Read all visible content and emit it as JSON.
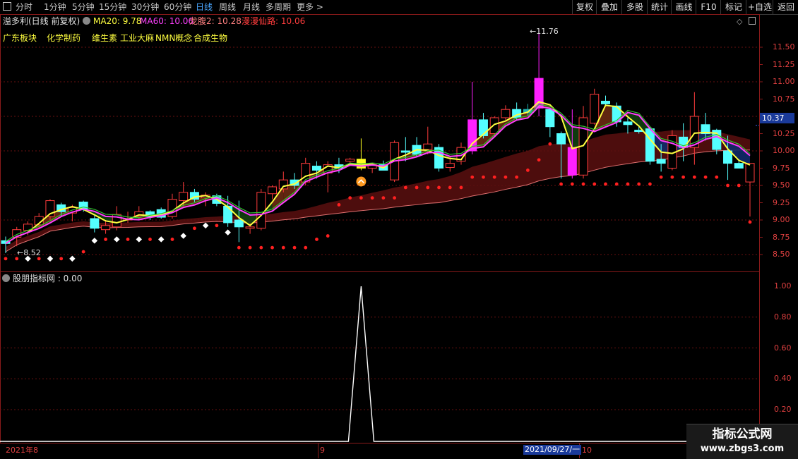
{
  "toolbar": {
    "menu_icon": "menu-icon",
    "periods": [
      "分时",
      "1分钟",
      "5分钟",
      "15分钟",
      "30分钟",
      "60分钟",
      "日线",
      "周线",
      "月线",
      "多周期",
      "更多 >"
    ],
    "active_period": "日线",
    "buttons": [
      "复权",
      "叠加",
      "多股",
      "统计",
      "画线",
      "F10",
      "标记",
      "+自选",
      "返回"
    ]
  },
  "main_panel": {
    "stock_title": "溢多利(日线 前复权)",
    "ma20": "MA20: 9.78",
    "ma60": "MA60: 10.06",
    "longbeidan": "龙腹2: 10.28",
    "manman": "漫漫仙路: 10.06",
    "concepts": [
      "广东板块",
      "化学制药",
      "维生素",
      "工业大麻",
      "NMN概念",
      "合成生物"
    ],
    "high_marker": "11.76",
    "low_marker": "8.52",
    "current_price": "10.37",
    "y_ticks": [
      "11.50",
      "11.25",
      "11.00",
      "10.75",
      "10.50",
      "10.25",
      "10.00",
      "9.75",
      "9.50",
      "9.25",
      "9.00",
      "8.75",
      "8.50"
    ]
  },
  "sub_panel": {
    "title": "股朋指标网 : 0.00",
    "y_ticks": [
      "1.00",
      "0.80",
      "0.60",
      "0.40",
      "0.20"
    ]
  },
  "date_axis": {
    "labels": [
      "2021年8",
      "9",
      "2021/09/27/一",
      "10"
    ]
  },
  "watermark": {
    "title": "指标公式网",
    "url": "www.zbgs3.com"
  },
  "colors": {
    "up": "#ff3c3c",
    "down": "#54ffff",
    "ma20": "#ffff40",
    "ma60": "#ff40ff",
    "grid": "#6a1010",
    "ribbon": "#7a1515"
  },
  "chart_data": {
    "type": "candlestick",
    "ylim": [
      8.4,
      11.85
    ],
    "candles": [
      {
        "o": 8.7,
        "h": 8.76,
        "l": 8.52,
        "c": 8.66
      },
      {
        "o": 8.75,
        "h": 8.9,
        "l": 8.62,
        "c": 8.86
      },
      {
        "o": 8.85,
        "h": 8.98,
        "l": 8.78,
        "c": 8.94
      },
      {
        "o": 8.93,
        "h": 9.1,
        "l": 8.88,
        "c": 9.05
      },
      {
        "o": 9.05,
        "h": 9.3,
        "l": 9.0,
        "c": 9.28
      },
      {
        "o": 9.22,
        "h": 9.25,
        "l": 9.05,
        "c": 9.12
      },
      {
        "o": 9.1,
        "h": 9.22,
        "l": 8.98,
        "c": 9.18
      },
      {
        "o": 9.26,
        "h": 9.28,
        "l": 9.12,
        "c": 9.16
      },
      {
        "o": 9.02,
        "h": 9.06,
        "l": 8.82,
        "c": 8.88
      },
      {
        "o": 8.86,
        "h": 9.0,
        "l": 8.8,
        "c": 8.92
      },
      {
        "o": 8.9,
        "h": 9.2,
        "l": 8.85,
        "c": 9.08
      },
      {
        "o": 9.0,
        "h": 9.12,
        "l": 8.96,
        "c": 9.02
      },
      {
        "o": 9.05,
        "h": 9.2,
        "l": 9.0,
        "c": 9.12
      },
      {
        "o": 9.12,
        "h": 9.14,
        "l": 9.0,
        "c": 9.05
      },
      {
        "o": 9.15,
        "h": 9.18,
        "l": 9.02,
        "c": 9.04
      },
      {
        "o": 9.05,
        "h": 9.38,
        "l": 9.02,
        "c": 9.3
      },
      {
        "o": 9.28,
        "h": 9.55,
        "l": 9.2,
        "c": 9.4
      },
      {
        "o": 9.4,
        "h": 9.45,
        "l": 9.26,
        "c": 9.3
      },
      {
        "o": 9.32,
        "h": 9.4,
        "l": 9.2,
        "c": 9.36
      },
      {
        "o": 9.35,
        "h": 9.38,
        "l": 9.2,
        "c": 9.24
      },
      {
        "o": 9.2,
        "h": 9.35,
        "l": 8.9,
        "c": 8.96
      },
      {
        "o": 9.0,
        "h": 9.28,
        "l": 8.68,
        "c": 8.9
      },
      {
        "o": 8.88,
        "h": 8.95,
        "l": 8.8,
        "c": 8.9
      },
      {
        "o": 8.88,
        "h": 9.45,
        "l": 8.85,
        "c": 9.4
      },
      {
        "o": 9.38,
        "h": 9.5,
        "l": 9.3,
        "c": 9.48
      },
      {
        "o": 9.45,
        "h": 9.7,
        "l": 9.4,
        "c": 9.58
      },
      {
        "o": 9.58,
        "h": 9.68,
        "l": 9.45,
        "c": 9.5
      },
      {
        "o": 9.55,
        "h": 9.9,
        "l": 9.5,
        "c": 9.82
      },
      {
        "o": 9.78,
        "h": 9.85,
        "l": 9.6,
        "c": 9.72
      },
      {
        "o": 9.68,
        "h": 9.85,
        "l": 9.4,
        "c": 9.8
      },
      {
        "o": 9.8,
        "h": 9.9,
        "l": 9.68,
        "c": 9.75
      },
      {
        "o": 9.85,
        "h": 9.9,
        "l": 9.78,
        "c": 9.88
      },
      {
        "o": 9.88,
        "h": 10.18,
        "l": 9.72,
        "c": 9.75
      },
      {
        "o": 9.75,
        "h": 9.8,
        "l": 9.68,
        "c": 9.8
      },
      {
        "o": 9.8,
        "h": 9.86,
        "l": 9.72,
        "c": 9.72
      },
      {
        "o": 9.58,
        "h": 10.15,
        "l": 9.55,
        "c": 10.12
      },
      {
        "o": 10.0,
        "h": 10.2,
        "l": 9.85,
        "c": 9.98
      },
      {
        "o": 10.08,
        "h": 10.2,
        "l": 9.92,
        "c": 9.95
      },
      {
        "o": 10.02,
        "h": 10.35,
        "l": 9.95,
        "c": 10.1
      },
      {
        "o": 10.05,
        "h": 10.1,
        "l": 9.7,
        "c": 9.75
      },
      {
        "o": 9.76,
        "h": 9.92,
        "l": 9.7,
        "c": 9.82
      },
      {
        "o": 9.85,
        "h": 10.12,
        "l": 9.8,
        "c": 10.05
      },
      {
        "o": 10.0,
        "h": 11.0,
        "l": 9.95,
        "c": 10.45
      },
      {
        "o": 10.45,
        "h": 10.55,
        "l": 10.18,
        "c": 10.22
      },
      {
        "o": 10.25,
        "h": 10.5,
        "l": 10.2,
        "c": 10.48
      },
      {
        "o": 10.48,
        "h": 10.66,
        "l": 10.45,
        "c": 10.6
      },
      {
        "o": 10.6,
        "h": 10.7,
        "l": 10.45,
        "c": 10.48
      },
      {
        "o": 10.55,
        "h": 10.68,
        "l": 10.5,
        "c": 10.6
      },
      {
        "o": 10.62,
        "h": 11.76,
        "l": 10.5,
        "c": 11.05
      },
      {
        "o": 10.6,
        "h": 10.62,
        "l": 10.2,
        "c": 10.35
      },
      {
        "o": 10.25,
        "h": 10.28,
        "l": 9.6,
        "c": 10.1
      },
      {
        "o": 10.05,
        "h": 10.6,
        "l": 9.6,
        "c": 9.65
      },
      {
        "o": 9.65,
        "h": 10.65,
        "l": 9.6,
        "c": 10.48
      },
      {
        "o": 10.4,
        "h": 10.9,
        "l": 10.38,
        "c": 10.82
      },
      {
        "o": 10.72,
        "h": 10.8,
        "l": 10.65,
        "c": 10.68
      },
      {
        "o": 10.65,
        "h": 10.7,
        "l": 10.35,
        "c": 10.42
      },
      {
        "o": 10.42,
        "h": 10.48,
        "l": 10.25,
        "c": 10.38
      },
      {
        "o": 10.3,
        "h": 10.35,
        "l": 10.25,
        "c": 10.28
      },
      {
        "o": 10.32,
        "h": 10.35,
        "l": 9.8,
        "c": 9.85
      },
      {
        "o": 9.88,
        "h": 10.1,
        "l": 9.7,
        "c": 9.82
      },
      {
        "o": 9.75,
        "h": 10.3,
        "l": 9.72,
        "c": 10.22
      },
      {
        "o": 10.2,
        "h": 10.4,
        "l": 9.85,
        "c": 10.05
      },
      {
        "o": 10.05,
        "h": 10.85,
        "l": 9.8,
        "c": 10.5
      },
      {
        "o": 10.38,
        "h": 10.55,
        "l": 10.15,
        "c": 10.25
      },
      {
        "o": 10.3,
        "h": 10.32,
        "l": 9.95,
        "c": 10.02
      },
      {
        "o": 10.0,
        "h": 10.22,
        "l": 9.58,
        "c": 9.82
      },
      {
        "o": 9.82,
        "h": 9.88,
        "l": 9.75,
        "c": 9.75
      },
      {
        "o": 9.55,
        "h": 9.82,
        "l": 9.05,
        "c": 9.82
      }
    ],
    "special_candles": {
      "yellow": [
        32
      ],
      "magenta": [
        42,
        48,
        51
      ],
      "teal": [
        47
      ]
    },
    "arrow_signal_index": 32,
    "sub_indicator": {
      "ylim": [
        0,
        1.05
      ],
      "values_index_peak": 32,
      "peak_value": 1.0
    }
  }
}
